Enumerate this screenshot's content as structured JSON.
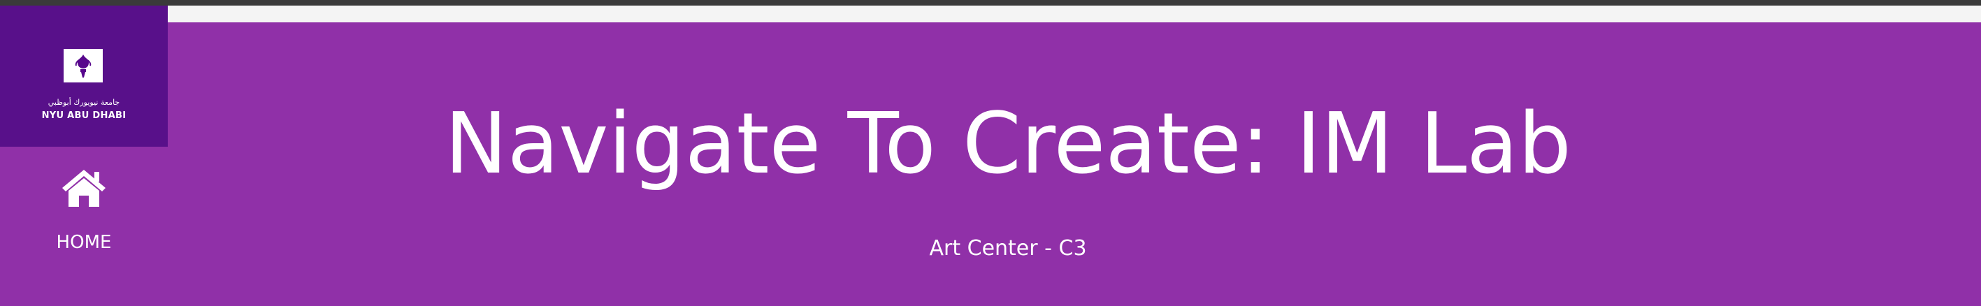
{
  "brand": {
    "arabic_name": "جامعة نيويورك أبوظبي",
    "english_name": "NYU ABU DHABI",
    "logo_icon": "torch-icon",
    "colors": {
      "logo_bg": "#58108a",
      "banner_bg": "#9030a8",
      "logo_torch": "#57068c"
    }
  },
  "nav": {
    "home_label": "HOME",
    "home_icon": "home-icon"
  },
  "header": {
    "title": "Navigate To Create: IM Lab",
    "subtitle": "Art Center - C3"
  }
}
